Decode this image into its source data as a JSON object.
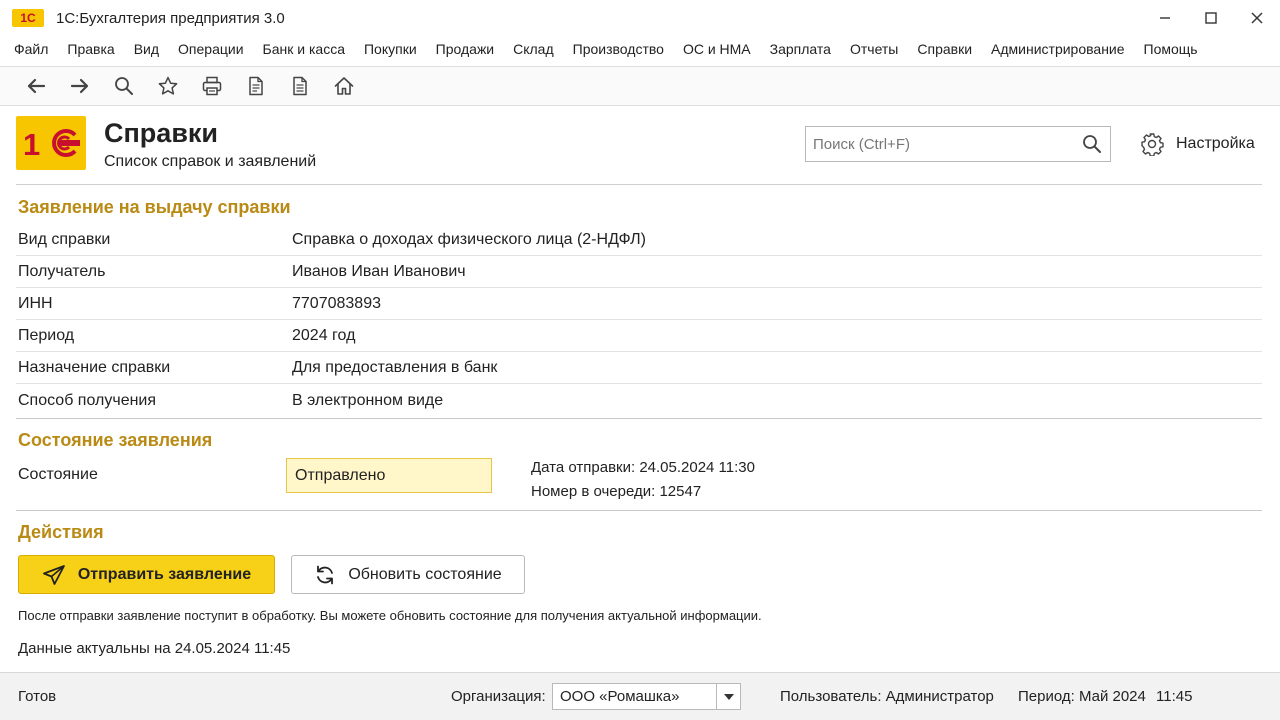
{
  "app": {
    "logo_text": "1С",
    "title": "1С:Бухгалтерия предприятия 3.0",
    "window_controls": [
      "minimize-icon",
      "maximize-icon",
      "close-icon"
    ]
  },
  "menu": [
    {
      "label": "Файл"
    },
    {
      "label": "Правка"
    },
    {
      "label": "Вид"
    },
    {
      "label": "Операции"
    },
    {
      "label": "Банк и касса"
    },
    {
      "label": "Покупки"
    },
    {
      "label": "Продажи"
    },
    {
      "label": "Склад"
    },
    {
      "label": "Производство"
    },
    {
      "label": "ОС и НМА"
    },
    {
      "label": "Зарплата"
    },
    {
      "label": "Отчеты"
    },
    {
      "label": "Справки"
    },
    {
      "label": "Администрирование"
    },
    {
      "label": "Помощь"
    }
  ],
  "toolbar": {
    "icons": [
      "back-icon",
      "forward-icon",
      "search-icon",
      "favorite-star-icon",
      "print-icon",
      "document-icon",
      "report-icon",
      "home-icon"
    ]
  },
  "header": {
    "title": "Справки",
    "subtitle": "Список справок и заявлений",
    "search_placeholder": "Поиск (Ctrl+F)",
    "settings_label": "Настройка"
  },
  "request": {
    "title": "Заявление на выдачу справки",
    "fields": [
      {
        "label": "Вид справки",
        "value": "Справка о доходах физического лица (2-НДФЛ)"
      },
      {
        "label": "Получатель",
        "value": "Иванов Иван Иванович"
      },
      {
        "label": "ИНН",
        "value": "7707083893"
      },
      {
        "label": "Период",
        "value": "2024 год"
      },
      {
        "label": "Назначение справки",
        "value": "Для предоставления в банк"
      },
      {
        "label": "Способ получения",
        "value": "В электронном виде"
      }
    ]
  },
  "status": {
    "title": "Состояние заявления",
    "label": "Состояние",
    "value": "Отправлено",
    "sent_date": "Дата отправки: 24.05.2024 11:30",
    "queue_number": "Номер в очереди: 12547"
  },
  "actions": {
    "title": "Действия",
    "send_label": "Отправить заявление",
    "refresh_label": "Обновить состояние",
    "note": "После отправки заявление поступит в обработку. Вы можете обновить состояние для получения актуальной информации.",
    "actual": "Данные актуальны на 24.05.2024 11:45"
  },
  "statusbar": {
    "ready": "Готов",
    "org_label": "Организация:",
    "org_value": "ООО «Ромашка»",
    "user": "Пользователь: Администратор",
    "period": "Период: Май 2024",
    "time": "11:45"
  },
  "colors": {
    "accent_yellow": "#f7d118",
    "section_title": "#b98a14",
    "status_bg": "#fff7c9",
    "logo_red": "#c8102e"
  }
}
